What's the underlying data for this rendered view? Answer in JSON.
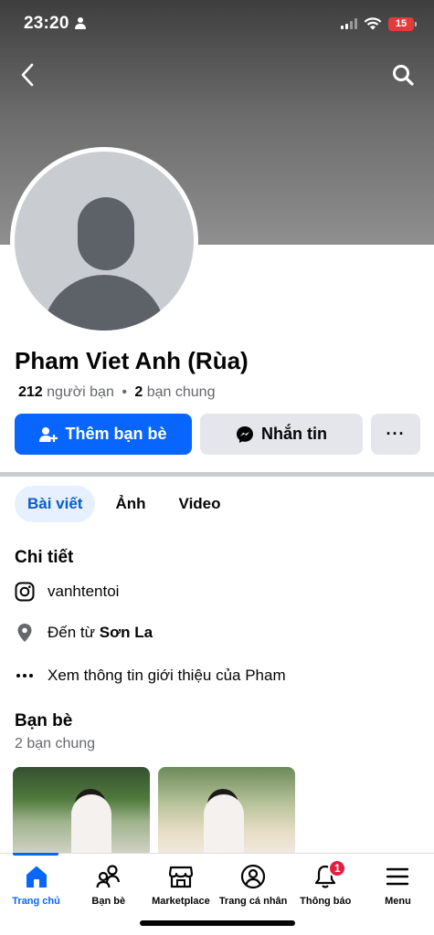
{
  "status_bar": {
    "time": "23:20",
    "battery": "15"
  },
  "profile": {
    "name": "Pham Viet Anh (Rùa)",
    "friend_count": "212",
    "friend_label": "người bạn",
    "separator": "•",
    "mutual_count": "2",
    "mutual_label": "bạn chung"
  },
  "actions": {
    "add_friend": "Thêm bạn bè",
    "message": "Nhắn tin",
    "more": "···"
  },
  "tabs": [
    "Bài viết",
    "Ảnh",
    "Video"
  ],
  "details": {
    "title": "Chi tiết",
    "instagram": "vanhtentoi",
    "from_prefix": "Đến từ",
    "from_place": "Sơn La",
    "see_more": "Xem thông tin giới thiệu của Pham"
  },
  "friends_section": {
    "title": "Bạn bè",
    "subtitle": "2 bạn chung"
  },
  "bottom_nav": [
    {
      "label": "Trang chủ",
      "icon": "home-icon"
    },
    {
      "label": "Bạn bè",
      "icon": "friends-icon"
    },
    {
      "label": "Marketplace",
      "icon": "marketplace-icon"
    },
    {
      "label": "Trang cá nhân",
      "icon": "profile-icon"
    },
    {
      "label": "Thông báo",
      "icon": "bell-icon",
      "badge": "1"
    },
    {
      "label": "Menu",
      "icon": "menu-icon"
    }
  ],
  "colors": {
    "primary": "#0866ff",
    "badge": "#e41e3f",
    "tab_active_bg": "#e7f0fe"
  }
}
